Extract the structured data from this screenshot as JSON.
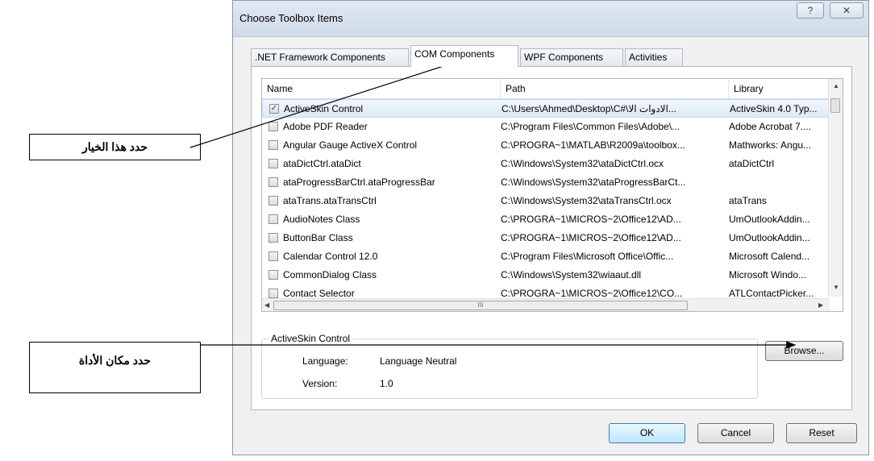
{
  "window": {
    "title": "Choose Toolbox Items",
    "help_glyph": "?",
    "close_glyph": "✕"
  },
  "tabs": [
    {
      "label": ".NET Framework Components"
    },
    {
      "label": "COM Components"
    },
    {
      "label": "WPF Components"
    },
    {
      "label": "Activities"
    }
  ],
  "list": {
    "columns": {
      "name": "Name",
      "path": "Path",
      "library": "Library"
    },
    "rows": [
      {
        "checked": true,
        "name": "ActiveSkin Control",
        "path": "C:\\Users\\Ahmed\\Desktop\\C#\\الادوات الا...",
        "library": "ActiveSkin 4.0 Typ..."
      },
      {
        "checked": false,
        "name": "Adobe PDF Reader",
        "path": "C:\\Program Files\\Common Files\\Adobe\\...",
        "library": "Adobe Acrobat 7...."
      },
      {
        "checked": false,
        "name": "Angular Gauge ActiveX Control",
        "path": "C:\\PROGRA~1\\MATLAB\\R2009a\\toolbox...",
        "library": "Mathworks: Angu..."
      },
      {
        "checked": false,
        "name": "ataDictCtrl.ataDict",
        "path": "C:\\Windows\\System32\\ataDictCtrl.ocx",
        "library": "ataDictCtrl"
      },
      {
        "checked": false,
        "name": "ataProgressBarCtrl.ataProgressBar",
        "path": "C:\\Windows\\System32\\ataProgressBarCt...",
        "library": ""
      },
      {
        "checked": false,
        "name": "ataTrans.ataTransCtrl",
        "path": "C:\\Windows\\System32\\ataTransCtrl.ocx",
        "library": "ataTrans"
      },
      {
        "checked": false,
        "name": "AudioNotes Class",
        "path": "C:\\PROGRA~1\\MICROS~2\\Office12\\AD...",
        "library": "UmOutlookAddin..."
      },
      {
        "checked": false,
        "name": "ButtonBar Class",
        "path": "C:\\PROGRA~1\\MICROS~2\\Office12\\AD...",
        "library": "UmOutlookAddin..."
      },
      {
        "checked": false,
        "name": "Calendar Control 12.0",
        "path": "C:\\Program Files\\Microsoft Office\\Offic...",
        "library": "Microsoft Calend..."
      },
      {
        "checked": false,
        "name": "CommonDialog Class",
        "path": "C:\\Windows\\System32\\wiaaut.dll",
        "library": "Microsoft Windo..."
      },
      {
        "checked": false,
        "name": "Contact Selector",
        "path": "C:\\PROGRA~1\\MICROS~2\\Office12\\CO...",
        "library": "ATLContactPicker..."
      }
    ],
    "scroll_up": "▲",
    "scroll_down": "▼",
    "scroll_left": "◀",
    "scroll_right": "▶",
    "hthumb_grip": "III"
  },
  "details": {
    "legend": "ActiveSkin Control",
    "language_label": "Language:",
    "language_value": "Language Neutral",
    "version_label": "Version:",
    "version_value": "1.0"
  },
  "buttons": {
    "browse": "Browse...",
    "ok": "OK",
    "cancel": "Cancel",
    "reset": "Reset"
  },
  "annotations": {
    "select_option": "حدد هذا الخيار",
    "select_location": "حدد مكان  الأداة"
  }
}
